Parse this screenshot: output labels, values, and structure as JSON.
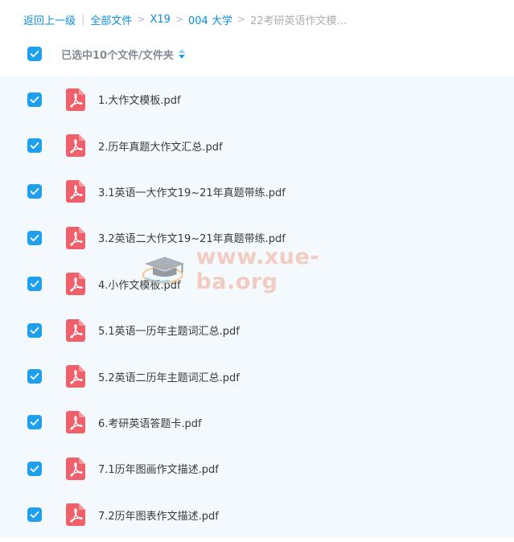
{
  "breadcrumb": {
    "back": "返回上一级",
    "items": [
      "全部文件",
      "X19",
      "004 大学"
    ],
    "current": "22考研英语作文模..."
  },
  "header": {
    "selection_text": "已选中10个文件/文件夹"
  },
  "files": [
    {
      "name": "1.大作文模板.pdf"
    },
    {
      "name": "2.历年真题大作文汇总.pdf"
    },
    {
      "name": "3.1英语一大作文19~21年真题带练.pdf"
    },
    {
      "name": "3.2英语二大作文19~21年真题带练.pdf"
    },
    {
      "name": "4.小作文模板.pdf"
    },
    {
      "name": "5.1英语一历年主题词汇总.pdf"
    },
    {
      "name": "5.2英语二历年主题词汇总.pdf"
    },
    {
      "name": "6.考研英语答题卡.pdf"
    },
    {
      "name": "7.1历年图画作文描述.pdf"
    },
    {
      "name": "7.2历年图表作文描述.pdf"
    }
  ],
  "watermark": {
    "text": "www.xue-ba.org",
    "icon": "graduation-cap-icon"
  },
  "colors": {
    "link": "#0b8fe0",
    "checkbox": "#1ea0ee",
    "pdf_icon": "#f0606b",
    "list_background": "#f4f9fd"
  },
  "icons": {
    "checkbox": "checkbox-checked-icon",
    "file": "pdf-file-icon",
    "sort": "sort-icon"
  }
}
